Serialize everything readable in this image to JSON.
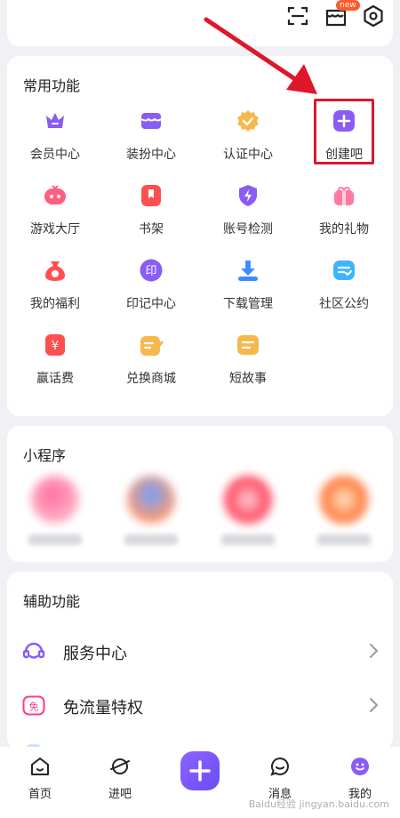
{
  "top": {
    "new_badge": "new"
  },
  "common": {
    "title": "常用功能",
    "items": [
      {
        "label": "会员中心",
        "icon": "crown-icon",
        "color": "#8a5cf6"
      },
      {
        "label": "装扮中心",
        "icon": "shop-icon",
        "color": "#8a5cf6"
      },
      {
        "label": "认证中心",
        "icon": "badge-check-icon",
        "color": "#f6b84d"
      },
      {
        "label": "创建吧",
        "icon": "plus-square-icon",
        "color": "#8a5cf6"
      },
      {
        "label": "游戏大厅",
        "icon": "gamepad-icon",
        "color": "#ff5f7e"
      },
      {
        "label": "书架",
        "icon": "bookmark-icon",
        "color": "#ff4f4f"
      },
      {
        "label": "账号检测",
        "icon": "shield-bolt-icon",
        "color": "#8a5cf6"
      },
      {
        "label": "我的礼物",
        "icon": "gift-icon",
        "color": "#ff7aa2"
      },
      {
        "label": "我的福利",
        "icon": "moneybag-icon",
        "color": "#ff4f4f"
      },
      {
        "label": "印记中心",
        "icon": "stamp-icon",
        "color": "#8a5cf6"
      },
      {
        "label": "下载管理",
        "icon": "download-icon",
        "color": "#3d8bff"
      },
      {
        "label": "社区公约",
        "icon": "chat-check-icon",
        "color": "#3db4ff"
      },
      {
        "label": "赢话费",
        "icon": "yuan-card-icon",
        "color": "#ff4f4f"
      },
      {
        "label": "兑换商城",
        "icon": "pencil-note-icon",
        "color": "#f6b84d"
      },
      {
        "label": "短故事",
        "icon": "note-card-icon",
        "color": "#f6b84d"
      }
    ]
  },
  "mini": {
    "title": "小程序",
    "items": [
      {
        "color": "#ff8fb0",
        "name": ""
      },
      {
        "color": "#7fb0ff",
        "name": ""
      },
      {
        "color": "#ff5a6e",
        "name": ""
      },
      {
        "color": "#ff8a4d",
        "name": ""
      }
    ]
  },
  "assist": {
    "title": "辅助功能",
    "items": [
      {
        "label": "服务中心",
        "icon": "headset-icon",
        "color": "#8a5cf6"
      },
      {
        "label": "免流量特权",
        "icon": "free-data-icon",
        "color": "#ff3b8e",
        "icon_text": "免"
      }
    ]
  },
  "nav": {
    "home": "首页",
    "explore": "进吧",
    "messages": "消息",
    "me": "我的"
  },
  "watermark": "Baidu经验 jingyan.baidu.com",
  "colors": {
    "accent": "#8a5cf6",
    "arrow": "#e0162b",
    "fab": "#6b4cf6"
  }
}
